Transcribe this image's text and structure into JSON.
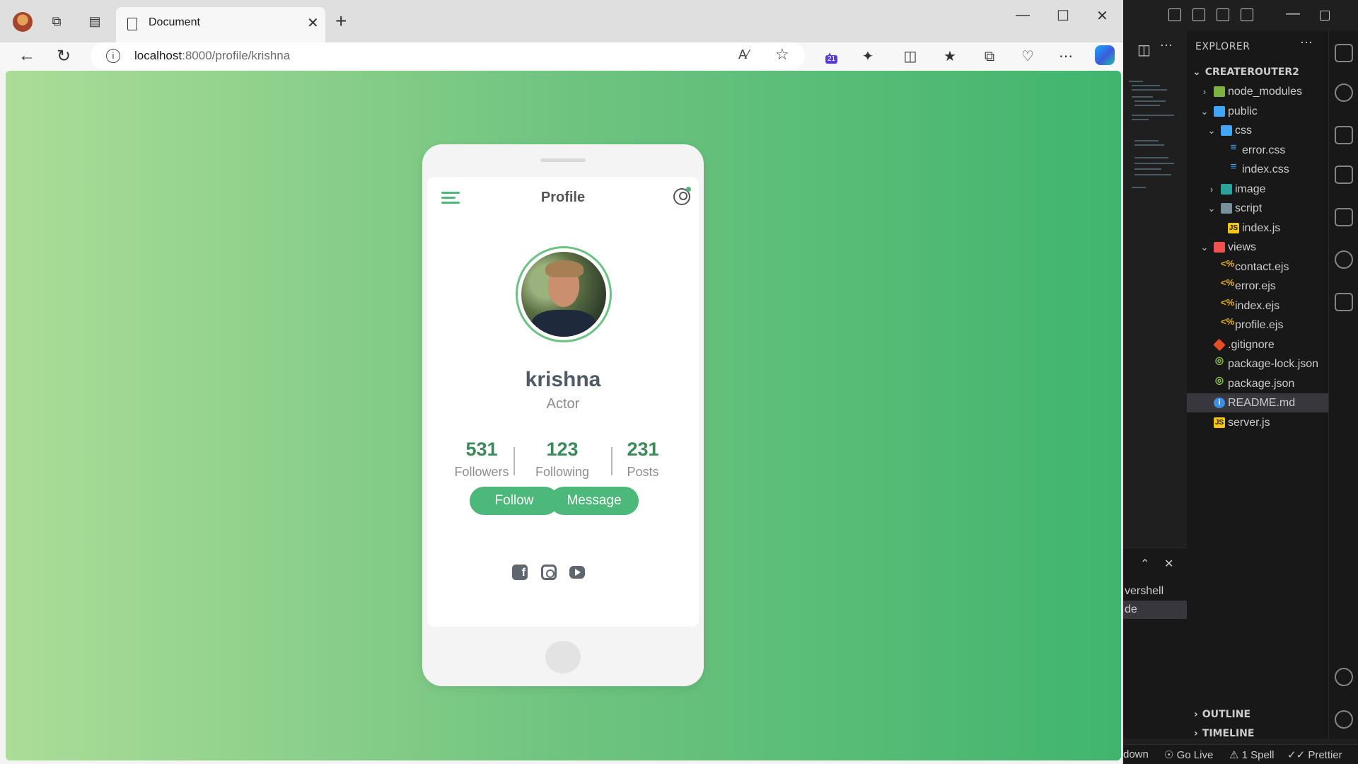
{
  "browser": {
    "tab_title": "Document",
    "url_host": "localhost",
    "url_rest": ":8000/profile/krishna",
    "extension_badge": "21"
  },
  "profile_page": {
    "screen_title": "Profile",
    "name": "krishna",
    "role": "Actor",
    "stats": [
      {
        "value": "531",
        "label": "Followers"
      },
      {
        "value": "123",
        "label": "Following"
      },
      {
        "value": "231",
        "label": "Posts"
      }
    ],
    "buttons": {
      "follow": "Follow",
      "message": "Message"
    },
    "social_icons": [
      "facebook-icon",
      "instagram-icon",
      "youtube-icon"
    ],
    "colors": {
      "accent": "#4cb879",
      "gradient_start": "#abdd98",
      "gradient_end": "#40b56e"
    }
  },
  "vscode": {
    "explorer_title": "EXPLORER",
    "project": "CREATEROUTER2",
    "tree": [
      {
        "label": "node_modules"
      },
      {
        "label": "public"
      },
      {
        "label": "css"
      },
      {
        "label": "error.css"
      },
      {
        "label": "index.css"
      },
      {
        "label": "image"
      },
      {
        "label": "script"
      },
      {
        "label": "index.js"
      },
      {
        "label": "views"
      },
      {
        "label": "contact.ejs"
      },
      {
        "label": "error.ejs"
      },
      {
        "label": "index.ejs"
      },
      {
        "label": "profile.ejs"
      },
      {
        "label": ".gitignore"
      },
      {
        "label": "package-lock.json"
      },
      {
        "label": "package.json"
      },
      {
        "label": "README.md"
      },
      {
        "label": "server.js"
      }
    ],
    "outline": "OUTLINE",
    "timeline": "TIMELINE",
    "terminal_rows": [
      "vershell",
      "de"
    ],
    "status": {
      "left": "down",
      "golive": "Go Live",
      "spell": "1 Spell",
      "prettier": "Prettier"
    }
  }
}
